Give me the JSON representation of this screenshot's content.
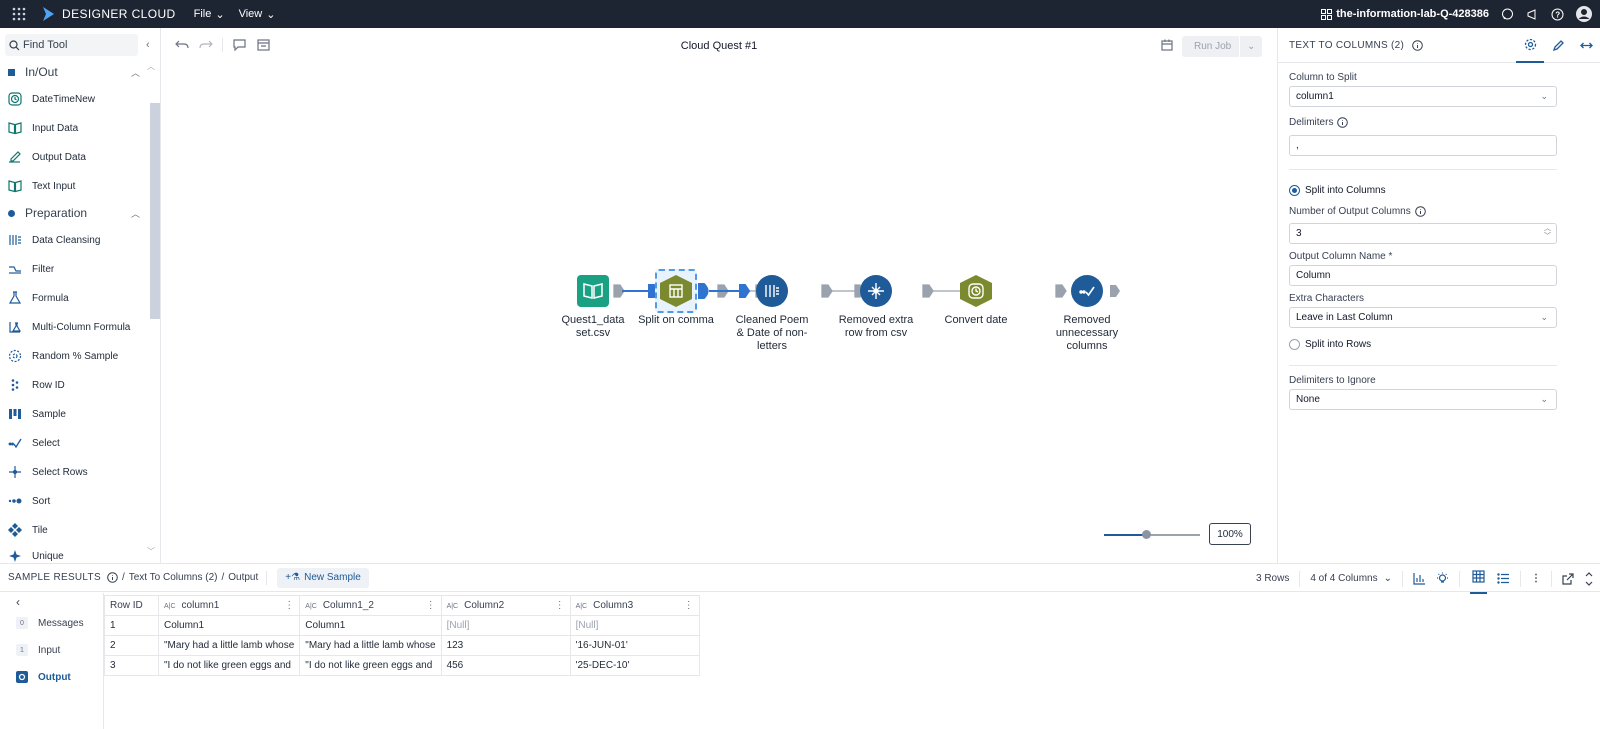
{
  "topbar": {
    "app_name": "DESIGNER CLOUD",
    "menu_file": "File",
    "menu_view": "View",
    "workspace": "the-information-lab-Q-428386"
  },
  "toolpanel": {
    "search_placeholder": "Find Tool",
    "sections": [
      {
        "label": "In/Out",
        "tools": [
          "DateTimeNew",
          "Input Data",
          "Output Data",
          "Text Input"
        ]
      },
      {
        "label": "Preparation",
        "tools": [
          "Data Cleansing",
          "Filter",
          "Formula",
          "Multi-Column Formula",
          "Random % Sample",
          "Row ID",
          "Sample",
          "Select",
          "Select Rows",
          "Sort",
          "Tile",
          "Unique"
        ]
      }
    ]
  },
  "canvas": {
    "title": "Cloud Quest #1",
    "run_job": "Run Job",
    "zoom": "100%",
    "zoom_level": 0.44,
    "nodes": [
      {
        "label": "Quest1_data set.csv",
        "icon": "book-icon",
        "color": "#1aa083"
      },
      {
        "label": "Split on comma",
        "icon": "text-to-columns-icon",
        "color": "#7b8a2e"
      },
      {
        "label": "Cleaned Poem & Date of non-letters",
        "icon": "data-cleansing-icon",
        "color": "#1f5a99"
      },
      {
        "label": "Removed extra row from csv",
        "icon": "select-rows-icon",
        "color": "#1f5a99"
      },
      {
        "label": "Convert date",
        "icon": "datetime-icon",
        "color": "#7b8a2e"
      },
      {
        "label": "Removed unnecessary columns",
        "icon": "select-icon",
        "color": "#1f5a99"
      }
    ]
  },
  "config": {
    "header": "TEXT TO COLUMNS (2)",
    "column_to_split_label": "Column to Split",
    "column_to_split": "column1",
    "delimiters_label": "Delimiters",
    "delimiters": ",",
    "split_columns_label": "Split into Columns",
    "num_output_label": "Number of Output Columns",
    "num_output": "3",
    "output_name_label": "Output Column Name *",
    "output_name": "Column",
    "extra_chars_label": "Extra Characters",
    "extra_chars": "Leave in Last Column",
    "split_rows_label": "Split into Rows",
    "ignore_label": "Delimiters to Ignore",
    "ignore": "None"
  },
  "results": {
    "title": "SAMPLE RESULTS",
    "crumb_tool": "Text To Columns (2)",
    "crumb_anchor": "Output",
    "new_sample": "New Sample",
    "rows": "3 Rows",
    "columns": "4 of 4 Columns",
    "nav": [
      {
        "label": "Messages",
        "badge": "0"
      },
      {
        "label": "Input",
        "badge": "1"
      },
      {
        "label": "Output",
        "badge": ""
      }
    ],
    "headers": [
      "Row ID",
      "column1",
      "Column1_2",
      "Column2",
      "Column3"
    ],
    "table_rows": [
      [
        "1",
        "Column1",
        "Column1",
        "[Null]",
        "[Null]"
      ],
      [
        "2",
        "\"Mary had a little lamb whose",
        "\"Mary had a little lamb whose",
        "123",
        "'16-JUN-01'"
      ],
      [
        "3",
        "\"I do not like green eggs and",
        "\"I do not like green eggs and",
        "456",
        "'25-DEC-10'"
      ]
    ]
  }
}
